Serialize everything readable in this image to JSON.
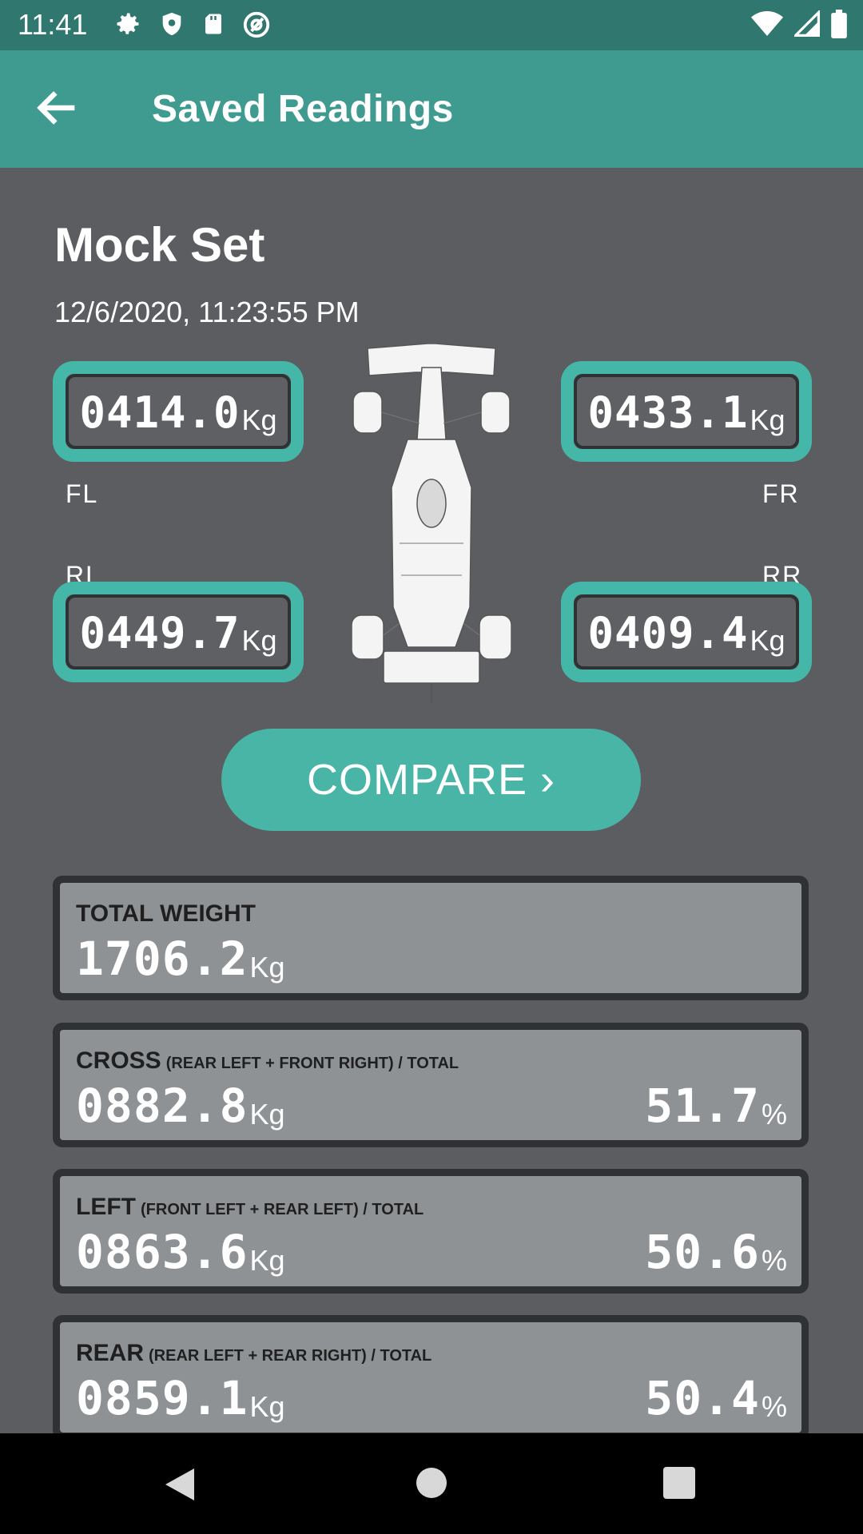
{
  "status_bar": {
    "time": "11:41",
    "icons_left": [
      "gear-icon",
      "shield-icon",
      "sd-card-icon",
      "at-sign-icon"
    ],
    "icons_right": [
      "wifi-icon",
      "signal-icon",
      "battery-icon"
    ]
  },
  "app_bar": {
    "title": "Saved Readings"
  },
  "reading": {
    "name": "Mock Set",
    "date": "12/6/2020, 11:23:55 PM",
    "unit": "Kg",
    "fl": {
      "label": "FL",
      "value": "0414.0"
    },
    "fr": {
      "label": "FR",
      "value": "0433.1"
    },
    "rl": {
      "label": "RL",
      "value": "0449.7"
    },
    "rr": {
      "label": "RR",
      "value": "0409.4"
    }
  },
  "compare_label": "COMPARE ›",
  "cards": [
    {
      "title": "TOTAL WEIGHT",
      "sub": "",
      "value": "1706.2",
      "unit": "Kg",
      "pct": "",
      "pct_unit": ""
    },
    {
      "title": "CROSS",
      "sub": "(REAR LEFT + FRONT RIGHT) / TOTAL",
      "value": "0882.8",
      "unit": "Kg",
      "pct": "51.7",
      "pct_unit": "%"
    },
    {
      "title": "LEFT",
      "sub": "(FRONT LEFT + REAR LEFT) / TOTAL",
      "value": "0863.6",
      "unit": "Kg",
      "pct": "50.6",
      "pct_unit": "%"
    },
    {
      "title": "REAR",
      "sub": "(REAR LEFT + REAR RIGHT) / TOTAL",
      "value": "0859.1",
      "unit": "Kg",
      "pct": "50.4",
      "pct_unit": "%"
    }
  ],
  "colors": {
    "accent": "#45b7a8",
    "app_bar": "#3f9b90",
    "status_bar": "#2f776f",
    "background": "#5c5d60"
  }
}
